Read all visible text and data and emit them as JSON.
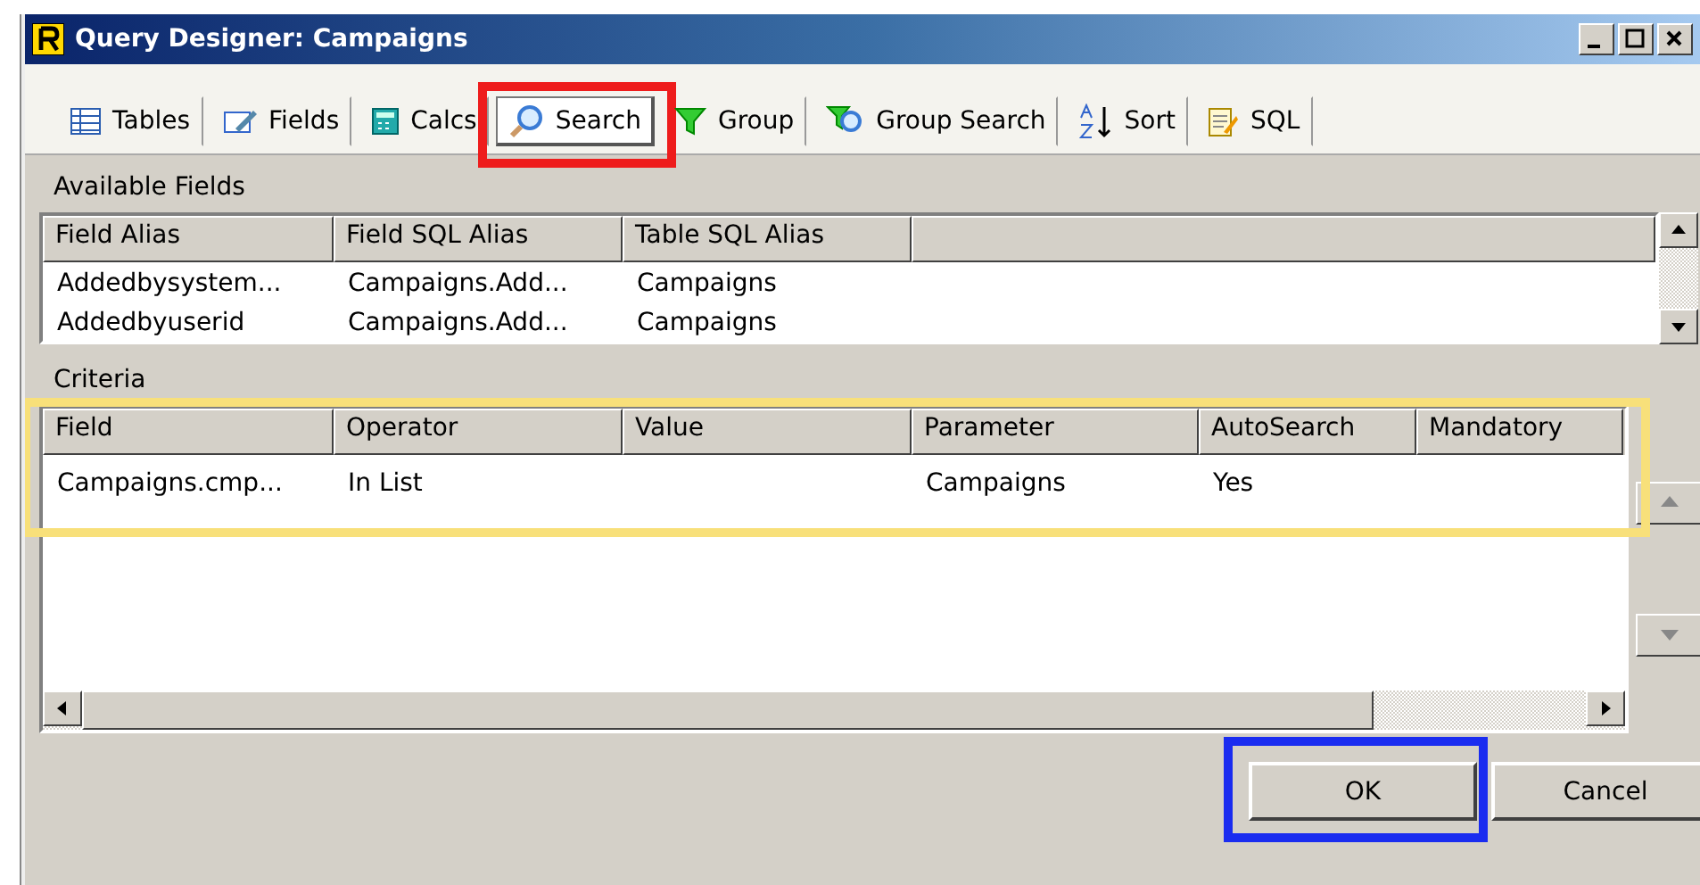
{
  "window": {
    "title": "Query Designer: Campaigns"
  },
  "tabs": [
    {
      "label": "Tables",
      "selected": false
    },
    {
      "label": "Fields",
      "selected": false
    },
    {
      "label": "Calcs",
      "selected": false
    },
    {
      "label": "Search",
      "selected": true,
      "highlighted": true
    },
    {
      "label": "Group",
      "selected": false
    },
    {
      "label": "Group Search",
      "selected": false
    },
    {
      "label": "Sort",
      "selected": false
    },
    {
      "label": "SQL",
      "selected": false
    }
  ],
  "available_fields": {
    "title": "Available Fields",
    "columns": [
      "Field Alias",
      "Field SQL Alias",
      "Table SQL Alias"
    ],
    "rows": [
      [
        "Addedbysystem...",
        "Campaigns.Add...",
        "Campaigns"
      ],
      [
        "Addedbyuserid",
        "Campaigns.Add...",
        "Campaigns"
      ]
    ]
  },
  "criteria": {
    "title": "Criteria",
    "highlighted": true,
    "columns": [
      "Field",
      "Operator",
      "Value",
      "Parameter",
      "AutoSearch",
      "Mandatory"
    ],
    "rows": [
      [
        "Campaigns.cmp...",
        "In List",
        "",
        "Campaigns",
        "Yes",
        ""
      ]
    ]
  },
  "buttons": [
    {
      "label": "OK",
      "highlighted": true
    },
    {
      "label": "Cancel"
    }
  ]
}
